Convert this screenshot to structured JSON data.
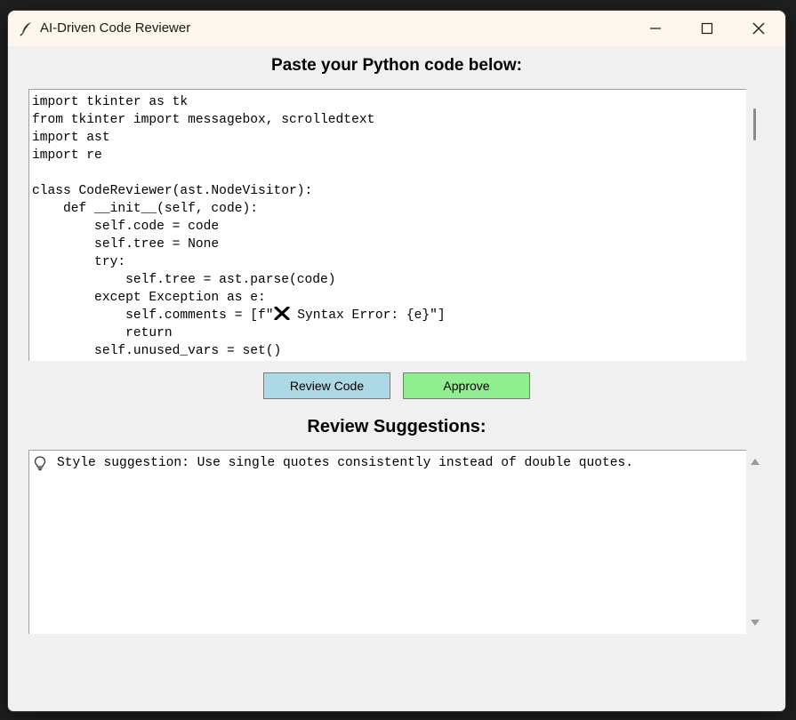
{
  "window": {
    "title": "AI-Driven Code Reviewer"
  },
  "code_section": {
    "heading": "Paste your Python code below:",
    "lines": [
      "import tkinter as tk",
      "from tkinter import messagebox, scrolledtext",
      "import ast",
      "import re",
      "",
      "class CodeReviewer(ast.NodeVisitor):",
      "    def __init__(self, code):",
      "        self.code = code",
      "        self.tree = None",
      "        try:",
      "            self.tree = ast.parse(code)",
      "        except Exception as e:",
      "            self.comments = [f\"",
      "            return",
      "        self.unused_vars = set()"
    ],
    "line13_tail": " Syntax Error: {e}\"]"
  },
  "buttons": {
    "review": "Review Code",
    "approve": "Approve"
  },
  "review_section": {
    "heading": "Review Suggestions:",
    "suggestion": "Style suggestion: Use single quotes consistently instead of double quotes."
  },
  "colors": {
    "review_button": "#add8e6",
    "approve_button": "#90ee90",
    "titlebar": "#fdf7ee"
  },
  "icons": [
    "feather-icon",
    "minimize-icon",
    "maximize-icon",
    "close-icon",
    "cross-mark-icon",
    "lightbulb-icon",
    "scroll-up-arrow-icon",
    "scroll-down-arrow-icon"
  ]
}
